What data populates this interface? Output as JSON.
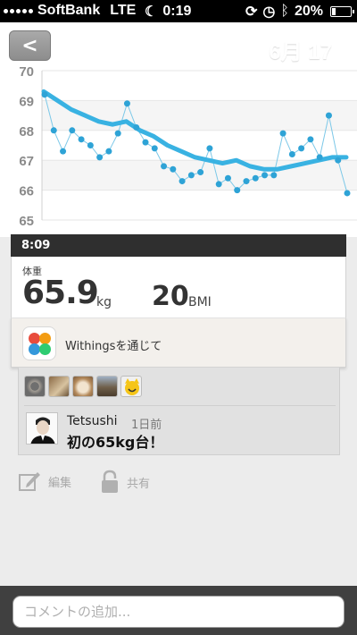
{
  "status_bar": {
    "carrier": "SoftBank",
    "network": "LTE",
    "time": "0:19",
    "battery_percent": "20%",
    "battery_level": 0.2
  },
  "header": {
    "back_label": "<",
    "date": "6月 17"
  },
  "chart_data": {
    "type": "line",
    "yticks": [
      "70",
      "69",
      "68",
      "67",
      "66",
      "65"
    ],
    "ylim": [
      65,
      70
    ],
    "grid": true,
    "series": [
      {
        "values": [
          69.2,
          68.0,
          67.3,
          68.0,
          67.7,
          67.5,
          67.1,
          67.3,
          67.9,
          68.9,
          68.1,
          67.6,
          67.4,
          66.8,
          66.7,
          66.3,
          66.5,
          66.6,
          67.4,
          66.2,
          66.4,
          66.0,
          66.3,
          66.4,
          66.5,
          66.5,
          67.9,
          67.2,
          67.4,
          67.7,
          67.1,
          68.5,
          67.0,
          65.9
        ]
      },
      {
        "values": [
          69.3,
          69.0,
          68.7,
          68.5,
          68.3,
          68.2,
          68.3,
          68.0,
          67.8,
          67.5,
          67.3,
          67.1,
          67.0,
          66.9,
          67.0,
          66.8,
          66.7,
          66.7,
          66.8,
          66.9,
          67.0,
          67.1,
          67.1
        ]
      }
    ],
    "colors": {
      "points": "#2ea3d6",
      "trend": "#39b2e2",
      "grid_band": "#f5f5f5"
    }
  },
  "card": {
    "time": "8:09",
    "weight_label": "体重",
    "weight_value": "65.9",
    "weight_unit": "kg",
    "bmi_value": "20",
    "bmi_unit": "BMI",
    "source": "Withingsを通じて"
  },
  "social": {
    "comment": {
      "user": "Tetsushi",
      "time": "1日前",
      "text": "初の65kg台！"
    }
  },
  "actions": {
    "edit": "編集",
    "share": "共有"
  },
  "footer": {
    "comment_placeholder": "コメントの追加..."
  }
}
